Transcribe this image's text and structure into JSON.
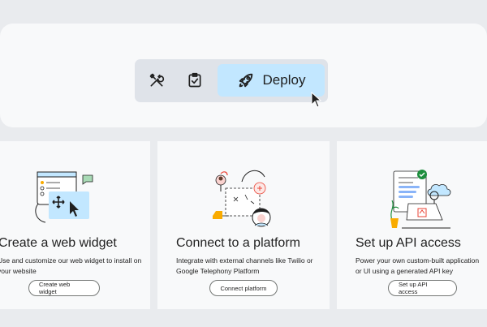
{
  "toolbar": {
    "icons": [
      "tools-icon",
      "clipboard-check-icon",
      "rocket-icon"
    ],
    "deploy_label": "Deploy"
  },
  "cards": [
    {
      "title": "Create a web widget",
      "description": "Use and customize our web widget to install on your website",
      "button": "Create web widget"
    },
    {
      "title": "Connect to a platform",
      "description": "Integrate with external channels like Twilio or Google Telephony Platform",
      "button": "Connect platform"
    },
    {
      "title": "Set up API access",
      "description": "Power your own custom-built application or UI using a generated API key",
      "button": "Set up API access"
    }
  ],
  "colors": {
    "page_bg": "#e9ebee",
    "panel_bg": "#f8f9fa",
    "toolbar_bg": "#dfe3e9",
    "deploy_bg": "#c2e7ff",
    "accent_blue": "#1a73e8",
    "accent_yellow": "#f9ab00",
    "accent_green": "#1e8e3e",
    "accent_red": "#ea4335"
  }
}
